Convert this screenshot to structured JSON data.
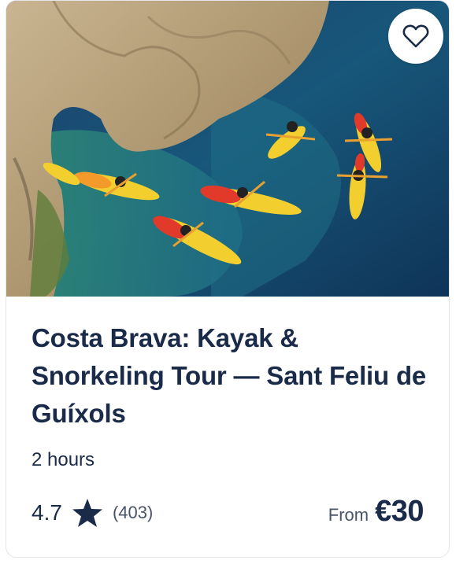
{
  "card": {
    "title": "Costa Brava: Kayak & Snorkeling Tour — Sant Feliu de Guíxols",
    "duration": "2 hours",
    "rating": "4.7",
    "review_count": "(403)",
    "price_prefix": "From",
    "price": "€30",
    "image": {
      "icon": "photo-kayaks-coast"
    },
    "favorite_icon": "heart-outline-icon",
    "rating_icon": "star-icon",
    "colors": {
      "text_primary": "#1a2b49",
      "text_secondary": "#4a5468",
      "border": "#e4e6ec",
      "water": "#1f5f7a",
      "kayak_yellow": "#f2cf2e",
      "kayak_red": "#e23a2a"
    }
  }
}
